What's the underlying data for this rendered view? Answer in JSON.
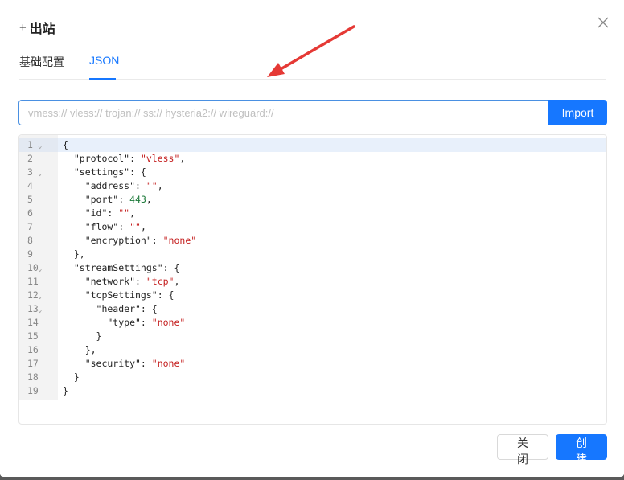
{
  "dialog": {
    "title_prefix": "+",
    "title": "出站"
  },
  "tabs": [
    {
      "label": "基础配置"
    },
    {
      "label": "JSON",
      "active": true
    }
  ],
  "import": {
    "placeholder": "vmess:// vless:// trojan:// ss:// hysteria2:// wireguard://",
    "button_label": "Import"
  },
  "editor": {
    "lines": [
      {
        "n": "1",
        "fold": true
      },
      {
        "n": "2"
      },
      {
        "n": "3",
        "fold": true
      },
      {
        "n": "4"
      },
      {
        "n": "5"
      },
      {
        "n": "6"
      },
      {
        "n": "7"
      },
      {
        "n": "8"
      },
      {
        "n": "9"
      },
      {
        "n": "10",
        "fold": true
      },
      {
        "n": "11"
      },
      {
        "n": "12",
        "fold": true
      },
      {
        "n": "13",
        "fold": true
      },
      {
        "n": "14"
      },
      {
        "n": "15"
      },
      {
        "n": "16"
      },
      {
        "n": "17"
      },
      {
        "n": "18"
      },
      {
        "n": "19"
      }
    ],
    "code": [
      {
        "k": "",
        "v": "{",
        "t": ""
      },
      {
        "k": "  \"protocol\": ",
        "v": "\"vless\"",
        "t": "str",
        "s": ","
      },
      {
        "k": "  \"settings\": {",
        "v": "",
        "t": ""
      },
      {
        "k": "    \"address\": ",
        "v": "\"\"",
        "t": "str",
        "s": ","
      },
      {
        "k": "    \"port\": ",
        "v": "443",
        "t": "num",
        "s": ","
      },
      {
        "k": "    \"id\": ",
        "v": "\"\"",
        "t": "str",
        "s": ","
      },
      {
        "k": "    \"flow\": ",
        "v": "\"\"",
        "t": "str",
        "s": ","
      },
      {
        "k": "    \"encryption\": ",
        "v": "\"none\"",
        "t": "str"
      },
      {
        "k": "  },",
        "v": "",
        "t": ""
      },
      {
        "k": "  \"streamSettings\": {",
        "v": "",
        "t": ""
      },
      {
        "k": "    \"network\": ",
        "v": "\"tcp\"",
        "t": "str",
        "s": ","
      },
      {
        "k": "    \"tcpSettings\": {",
        "v": "",
        "t": ""
      },
      {
        "k": "      \"header\": {",
        "v": "",
        "t": ""
      },
      {
        "k": "        \"type\": ",
        "v": "\"none\"",
        "t": "str"
      },
      {
        "k": "      }",
        "v": "",
        "t": ""
      },
      {
        "k": "    },",
        "v": "",
        "t": ""
      },
      {
        "k": "    \"security\": ",
        "v": "\"none\"",
        "t": "str"
      },
      {
        "k": "  }",
        "v": "",
        "t": ""
      },
      {
        "k": "}",
        "v": "",
        "t": ""
      }
    ]
  },
  "footer": {
    "close_label": "关闭",
    "create_label": "创建"
  },
  "colors": {
    "primary": "#1677ff",
    "annotation_arrow": "#e53935"
  }
}
